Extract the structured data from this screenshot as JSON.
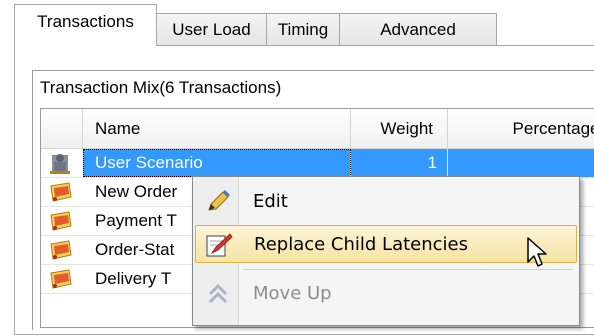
{
  "tabs": [
    {
      "label": "Transactions",
      "active": true
    },
    {
      "label": "User Load",
      "active": false
    },
    {
      "label": "Timing",
      "active": false
    },
    {
      "label": "Advanced",
      "active": false
    }
  ],
  "group": {
    "title": "Transaction Mix(6 Transactions)"
  },
  "grid": {
    "columns": {
      "name": "Name",
      "weight": "Weight",
      "percentages": "Percentages"
    },
    "rows": [
      {
        "icon": "user-scenario-icon",
        "name": "User Scenario",
        "weight": "1",
        "selected": true
      },
      {
        "icon": "transaction-icon",
        "name": "New Order",
        "weight": "",
        "selected": false
      },
      {
        "icon": "transaction-icon",
        "name": "Payment T",
        "weight": "",
        "selected": false
      },
      {
        "icon": "transaction-icon",
        "name": "Order-Stat",
        "weight": "",
        "selected": false
      },
      {
        "icon": "transaction-icon",
        "name": "Delivery T",
        "weight": "",
        "selected": false
      }
    ]
  },
  "context_menu": {
    "items": [
      {
        "label": "Edit",
        "icon": "pencil-icon",
        "enabled": true,
        "highlighted": false
      },
      {
        "label": "Replace Child Latencies",
        "icon": "replace-latency-icon",
        "enabled": true,
        "highlighted": true
      },
      {
        "label": "Move Up",
        "icon": "double-chevron-up-icon",
        "enabled": false,
        "highlighted": false
      }
    ]
  },
  "colors": {
    "selection": "#3399ff",
    "menu_highlight": "#f7e3a3",
    "tab_border": "#a7a7a7"
  }
}
